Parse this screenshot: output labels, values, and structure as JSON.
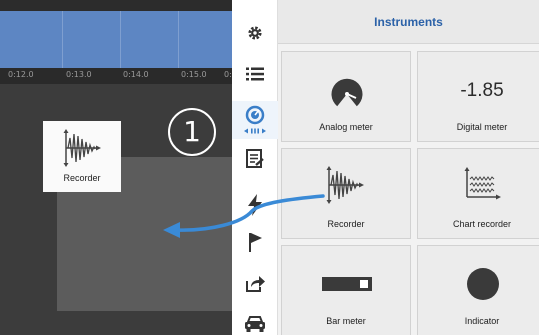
{
  "timeline": {
    "ticks": [
      "0:12.0",
      "0:13.0",
      "0:14.0",
      "0:15.0",
      "0:"
    ]
  },
  "recorder_tile": {
    "label": "Recorder"
  },
  "callout": {
    "number": "1"
  },
  "toolbar": {
    "items": [
      {
        "icon": "gear-icon"
      },
      {
        "icon": "list-icon"
      },
      {
        "icon": "gauge-icon",
        "active": true
      },
      {
        "icon": "report-icon"
      },
      {
        "icon": "lightning-icon"
      },
      {
        "icon": "flag-icon"
      },
      {
        "icon": "share-icon"
      },
      {
        "icon": "car-icon"
      }
    ]
  },
  "panel": {
    "title": "Instruments",
    "instruments": [
      {
        "label": "Analog meter",
        "icon": "analog-meter-icon"
      },
      {
        "label": "Digital meter",
        "value": "-1.85"
      },
      {
        "label": "Recorder",
        "icon": "recorder-icon"
      },
      {
        "label": "Chart recorder",
        "icon": "chart-recorder-icon"
      },
      {
        "label": "Bar meter",
        "icon": "bar-meter-icon"
      },
      {
        "label": "Indicator",
        "icon": "indicator-icon"
      }
    ]
  },
  "colors": {
    "accent": "#2c62a8",
    "waveform_band": "#5d86c3",
    "gauge_blue": "#3a7ec8",
    "arrow_blue": "#3a8ad6"
  }
}
